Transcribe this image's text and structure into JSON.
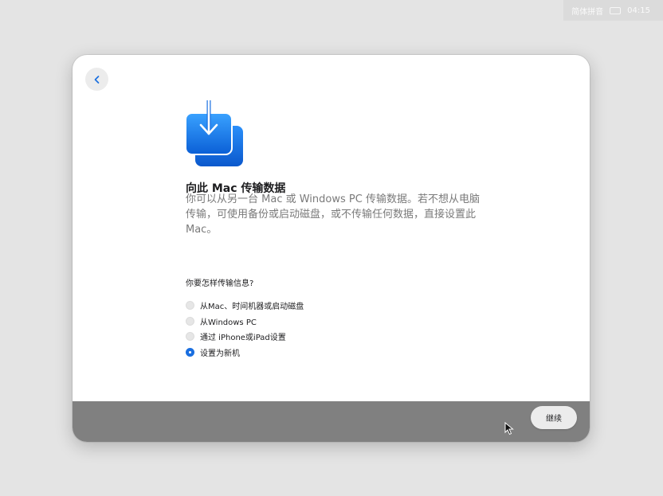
{
  "menubar": {
    "input_method": "简体拼音",
    "time": "04:15"
  },
  "window": {
    "back_icon": "chevron-left-icon",
    "hero_icon": "download-to-mac-icon",
    "title": "向此 Mac 传输数据",
    "description": "你可以从另一台 Mac 或 Windows PC 传输数据。若不想从电脑传输，可使用备份或启动磁盘，或不传输任何数据，直接设置此 Mac。",
    "question": "你要怎样传输信息?",
    "options": [
      {
        "label": "从Mac、时间机器或启动磁盘",
        "selected": false
      },
      {
        "label": "从Windows PC",
        "selected": false
      },
      {
        "label": "通过 iPhone或iPad设置",
        "selected": false
      },
      {
        "label": "设置为新机",
        "selected": true
      }
    ],
    "continue_label": "继续"
  },
  "colors": {
    "accent": "#1a6fe0",
    "footer": "#808080",
    "desktop": "#e4e4e4"
  }
}
